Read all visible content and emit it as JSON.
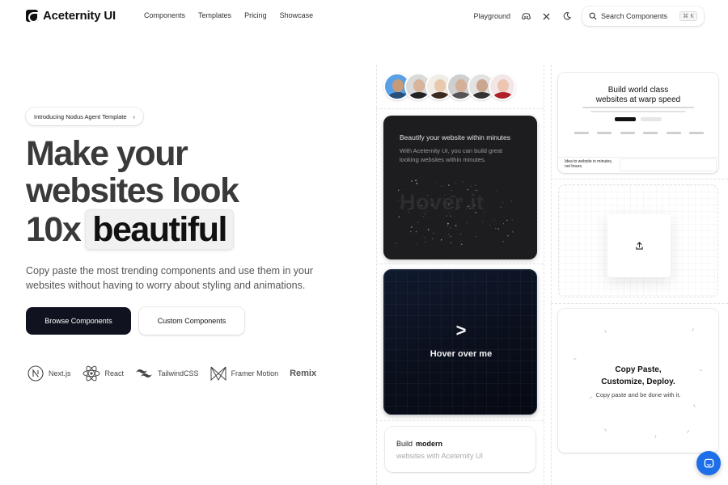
{
  "brand": {
    "name": "Aceternity UI"
  },
  "nav": {
    "links": [
      "Components",
      "Templates",
      "Pricing",
      "Showcase"
    ],
    "playground": "Playground",
    "search_label": "Search Components",
    "search_shortcut": "⌘ K"
  },
  "hero": {
    "pill": "Introducing Nodus Agent Template",
    "pill_arrow": "›",
    "headline_line1": "Make your",
    "headline_line2": "websites look",
    "headline_prefix": "10x",
    "headline_highlight": "beautiful",
    "subtitle": "Copy paste the most trending components and use them in your websites without having to worry about styling and animations.",
    "primary_button": "Browse Components",
    "secondary_button": "Custom Components"
  },
  "tech_stack": [
    "Next.js",
    "React",
    "TailwindCSS",
    "Framer Motion",
    "Remix"
  ],
  "cards": {
    "dark": {
      "title": "Beautify your website within minutes",
      "body": "With Aceternity UI, you can build great looking websites within minutes.",
      "hover_text": "Hover it"
    },
    "night": {
      "chevron": ">",
      "label": "Hover over me"
    },
    "build": {
      "prefix": "Build",
      "word": "modern",
      "line2": "websites with Aceternity UI"
    },
    "site": {
      "headline_line1": "Build world class",
      "headline_line2": "websites at warp speed",
      "section_text": "Idea to website in minutes, not hours."
    },
    "copy": {
      "line1": "Copy Paste,",
      "line2": "Customize, Deploy.",
      "body": "Copy paste and be done with it."
    }
  },
  "colors": {
    "primary_button": "#10131f",
    "chat_button": "#1c6fe8",
    "dark_card": "#1d1d1f"
  },
  "icons": [
    "discord-icon",
    "x-icon",
    "moon-icon",
    "search-icon",
    "upload-icon",
    "chat-icon"
  ]
}
